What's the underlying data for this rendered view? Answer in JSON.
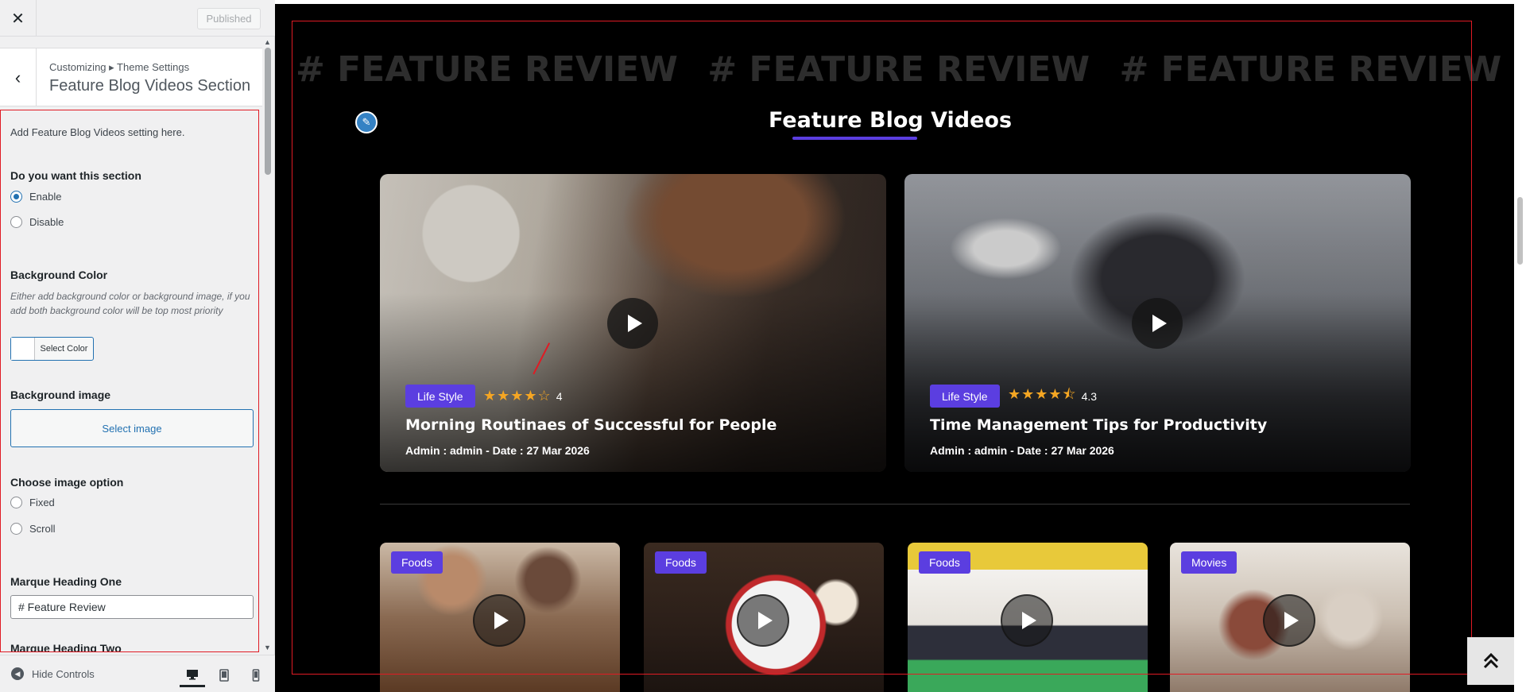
{
  "header": {
    "close_icon": "close-icon",
    "publish_label": "Published"
  },
  "panel_title": {
    "breadcrumb": "Customizing ▸ Theme Settings",
    "title": "Feature Blog Videos Section"
  },
  "controls": {
    "description": "Add Feature Blog Videos setting here.",
    "section_toggle": {
      "label": "Do you want this section",
      "options": [
        "Enable",
        "Disable"
      ],
      "selected": "Enable"
    },
    "background_color": {
      "label": "Background Color",
      "note": "Either add background color or background image, if you add both background color will be top most priority",
      "button": "Select Color"
    },
    "background_image": {
      "label": "Background image",
      "button": "Select image"
    },
    "image_option": {
      "label": "Choose image option",
      "options": [
        "Fixed",
        "Scroll"
      ]
    },
    "marque_one": {
      "label": "Marque Heading One",
      "value": "# Feature Review"
    },
    "marque_two": {
      "label": "Marque Heading Two"
    }
  },
  "footer": {
    "hide_controls": "Hide Controls",
    "devices": [
      "desktop-icon",
      "tablet-icon",
      "mobile-icon"
    ]
  },
  "preview": {
    "marquee": [
      "# FEATURE REVIEW",
      "# FEATURE REVIEW",
      "# FEATURE REVIEW"
    ],
    "section_title": "Feature Blog Videos",
    "accent_color": "#5b3ee0",
    "big_cards": [
      {
        "tag": "Life Style",
        "stars": "★★★★☆",
        "rating": "4",
        "title": "Morning Routinaes of Successful for People",
        "meta": "Admin : admin   -   Date : 27 Mar 2026"
      },
      {
        "tag": "Life Style",
        "stars": "★★★★⯪",
        "rating": "4.3",
        "title": "Time Management Tips for Productivity",
        "meta": "Admin : admin   -   Date : 27 Mar 2026"
      }
    ],
    "small_cards": [
      {
        "tag": "Foods"
      },
      {
        "tag": "Foods"
      },
      {
        "tag": "Foods"
      },
      {
        "tag": "Movies"
      }
    ]
  }
}
